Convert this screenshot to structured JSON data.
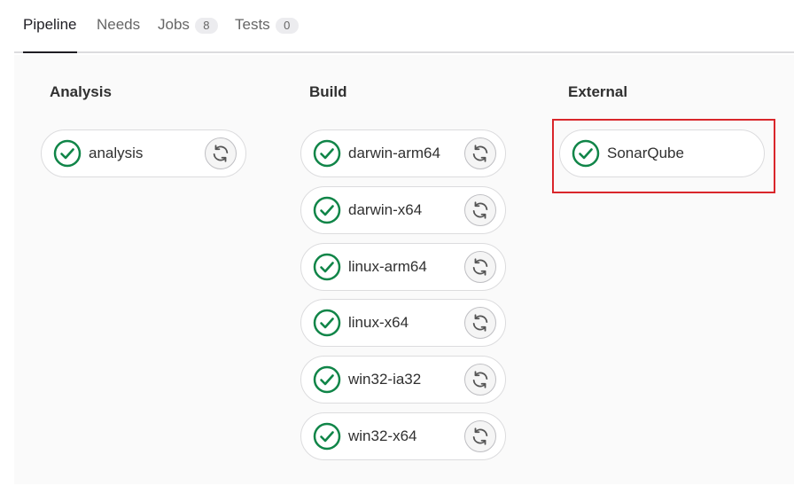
{
  "tabs": [
    {
      "label": "Pipeline",
      "count": null,
      "active": true
    },
    {
      "label": "Needs",
      "count": null,
      "active": false
    },
    {
      "label": "Jobs",
      "count": "8",
      "active": false
    },
    {
      "label": "Tests",
      "count": "0",
      "active": false
    }
  ],
  "stages": [
    {
      "title": "Analysis",
      "jobs": [
        {
          "name": "analysis",
          "status": "success",
          "retry": true
        }
      ]
    },
    {
      "title": "Build",
      "jobs": [
        {
          "name": "darwin-arm64",
          "status": "success",
          "retry": true
        },
        {
          "name": "darwin-x64",
          "status": "success",
          "retry": true
        },
        {
          "name": "linux-arm64",
          "status": "success",
          "retry": true
        },
        {
          "name": "linux-x64",
          "status": "success",
          "retry": true
        },
        {
          "name": "win32-ia32",
          "status": "success",
          "retry": true
        },
        {
          "name": "win32-x64",
          "status": "success",
          "retry": true
        }
      ]
    },
    {
      "title": "External",
      "jobs": [
        {
          "name": "SonarQube",
          "status": "success",
          "retry": false
        }
      ]
    }
  ],
  "colors": {
    "success": "#108548",
    "highlight": "#d9262b"
  },
  "icons": {
    "status": "check-circle-icon",
    "retry": "retry-icon"
  }
}
